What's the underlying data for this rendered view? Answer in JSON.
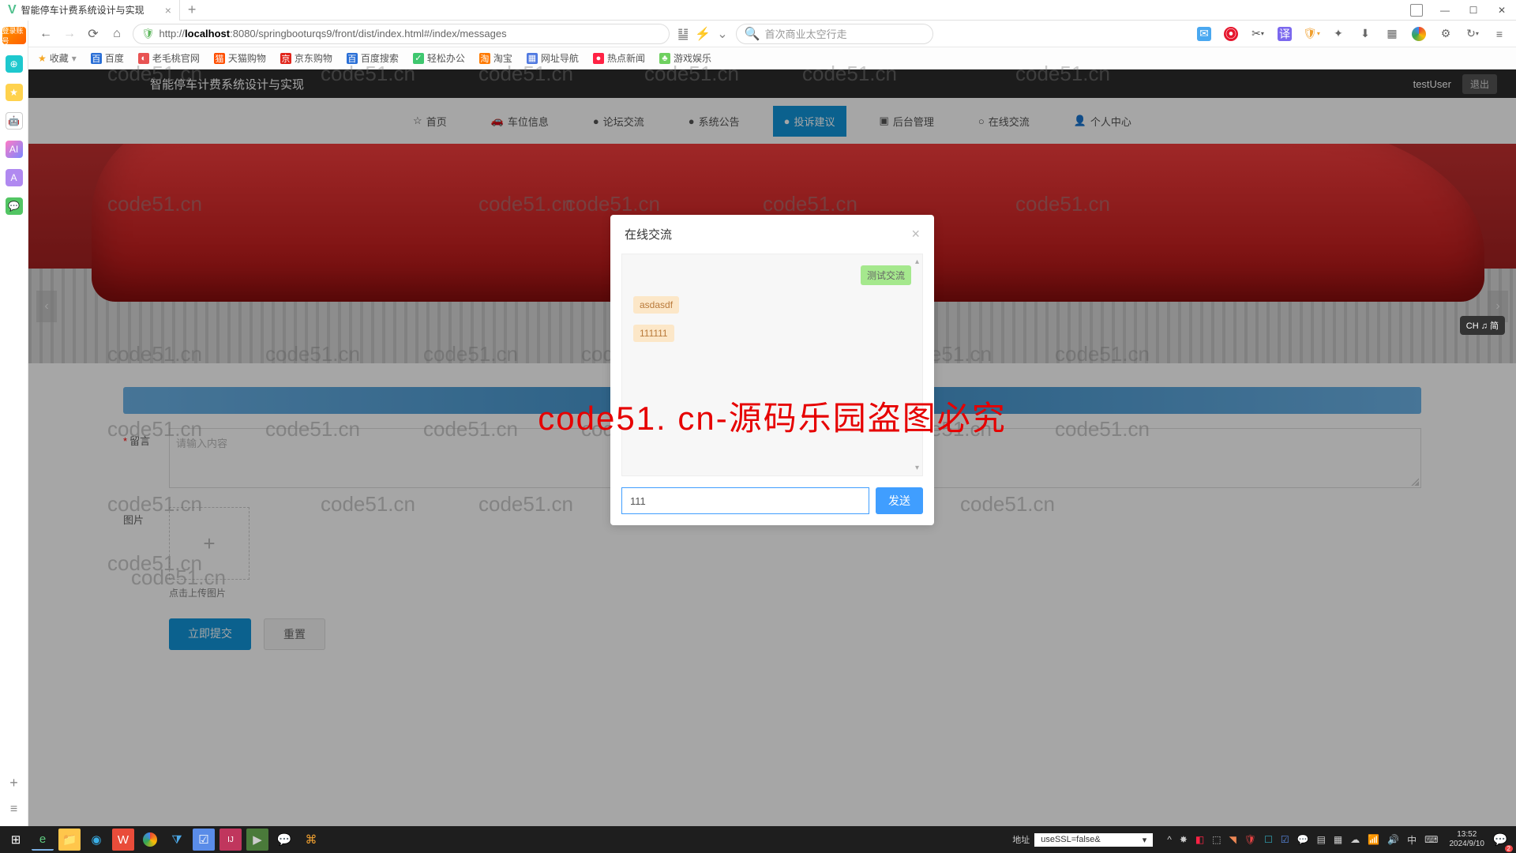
{
  "window": {
    "tab_title": "智能停车计费系统设计与实现",
    "url_prefix": "http://",
    "url_bold": "localhost",
    "url_rest": ":8080/springbooturqs9/front/dist/index.html#/index/messages",
    "search_placeholder": "首次商业太空行走"
  },
  "bookmarks": {
    "fav": "收藏",
    "items": [
      "百度",
      "老毛桃官网",
      "天猫购物",
      "京东购物",
      "百度搜索",
      "轻松办公",
      "淘宝",
      "网址导航",
      "热点新闻",
      "游戏娱乐"
    ]
  },
  "app": {
    "title": "智能停车计费系统设计与实现",
    "user": "testUser",
    "logout": "退出"
  },
  "nav": {
    "home": "首页",
    "parking": "车位信息",
    "forum": "论坛交流",
    "notice": "系统公告",
    "complain": "投诉建议",
    "admin": "后台管理",
    "chat": "在线交流",
    "profile": "个人中心"
  },
  "form": {
    "label_msg": "留言",
    "placeholder_msg": "请输入内容",
    "label_img": "图片",
    "upload_hint": "点击上传图片",
    "submit": "立即提交",
    "reset": "重置"
  },
  "modal": {
    "title": "在线交流",
    "send": "发送",
    "input_value": "111",
    "msg1": "测试交流",
    "msg2": "asdasdf",
    "msg3": "111111"
  },
  "ime": "CH ♫ 简",
  "watermark_text": "code51.cn",
  "big_watermark": "code51. cn-源码乐园盗图必究",
  "taskbar": {
    "addr_label": "地址",
    "dropdown": "useSSL=false&",
    "time": "13:52",
    "date": "2024/9/10"
  }
}
